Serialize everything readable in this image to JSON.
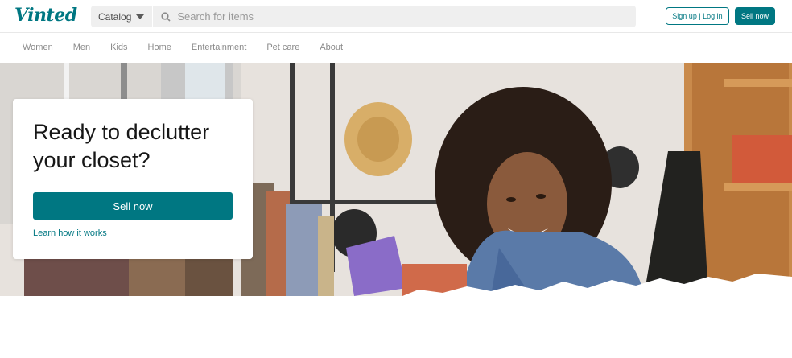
{
  "header": {
    "logo": "Vinted",
    "catalog_label": "Catalog",
    "search_placeholder": "Search for items",
    "signup_label": "Sign up | Log in",
    "sell_label": "Sell now"
  },
  "nav": {
    "items": [
      "Women",
      "Men",
      "Kids",
      "Home",
      "Entertainment",
      "Pet care",
      "About"
    ]
  },
  "hero": {
    "title": "Ready to declutter your closet?",
    "sell_button": "Sell now",
    "learn_link": "Learn how it works"
  },
  "colors": {
    "brand": "#007782"
  },
  "icons": [
    "search-icon",
    "chevron-down-icon"
  ]
}
